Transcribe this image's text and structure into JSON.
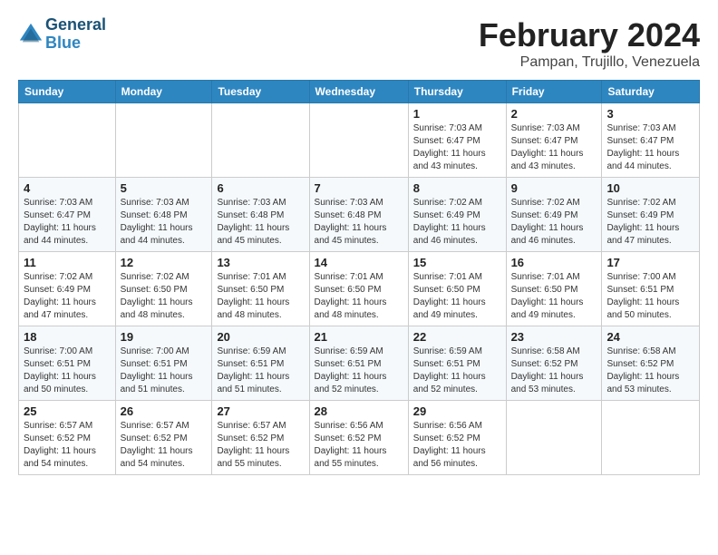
{
  "header": {
    "logo_line1": "General",
    "logo_line2": "Blue",
    "title": "February 2024",
    "location": "Pampan, Trujillo, Venezuela"
  },
  "days_of_week": [
    "Sunday",
    "Monday",
    "Tuesday",
    "Wednesday",
    "Thursday",
    "Friday",
    "Saturday"
  ],
  "weeks": [
    [
      {
        "day": "",
        "info": ""
      },
      {
        "day": "",
        "info": ""
      },
      {
        "day": "",
        "info": ""
      },
      {
        "day": "",
        "info": ""
      },
      {
        "day": "1",
        "info": "Sunrise: 7:03 AM\nSunset: 6:47 PM\nDaylight: 11 hours and 43 minutes."
      },
      {
        "day": "2",
        "info": "Sunrise: 7:03 AM\nSunset: 6:47 PM\nDaylight: 11 hours and 43 minutes."
      },
      {
        "day": "3",
        "info": "Sunrise: 7:03 AM\nSunset: 6:47 PM\nDaylight: 11 hours and 44 minutes."
      }
    ],
    [
      {
        "day": "4",
        "info": "Sunrise: 7:03 AM\nSunset: 6:47 PM\nDaylight: 11 hours and 44 minutes."
      },
      {
        "day": "5",
        "info": "Sunrise: 7:03 AM\nSunset: 6:48 PM\nDaylight: 11 hours and 44 minutes."
      },
      {
        "day": "6",
        "info": "Sunrise: 7:03 AM\nSunset: 6:48 PM\nDaylight: 11 hours and 45 minutes."
      },
      {
        "day": "7",
        "info": "Sunrise: 7:03 AM\nSunset: 6:48 PM\nDaylight: 11 hours and 45 minutes."
      },
      {
        "day": "8",
        "info": "Sunrise: 7:02 AM\nSunset: 6:49 PM\nDaylight: 11 hours and 46 minutes."
      },
      {
        "day": "9",
        "info": "Sunrise: 7:02 AM\nSunset: 6:49 PM\nDaylight: 11 hours and 46 minutes."
      },
      {
        "day": "10",
        "info": "Sunrise: 7:02 AM\nSunset: 6:49 PM\nDaylight: 11 hours and 47 minutes."
      }
    ],
    [
      {
        "day": "11",
        "info": "Sunrise: 7:02 AM\nSunset: 6:49 PM\nDaylight: 11 hours and 47 minutes."
      },
      {
        "day": "12",
        "info": "Sunrise: 7:02 AM\nSunset: 6:50 PM\nDaylight: 11 hours and 48 minutes."
      },
      {
        "day": "13",
        "info": "Sunrise: 7:01 AM\nSunset: 6:50 PM\nDaylight: 11 hours and 48 minutes."
      },
      {
        "day": "14",
        "info": "Sunrise: 7:01 AM\nSunset: 6:50 PM\nDaylight: 11 hours and 48 minutes."
      },
      {
        "day": "15",
        "info": "Sunrise: 7:01 AM\nSunset: 6:50 PM\nDaylight: 11 hours and 49 minutes."
      },
      {
        "day": "16",
        "info": "Sunrise: 7:01 AM\nSunset: 6:50 PM\nDaylight: 11 hours and 49 minutes."
      },
      {
        "day": "17",
        "info": "Sunrise: 7:00 AM\nSunset: 6:51 PM\nDaylight: 11 hours and 50 minutes."
      }
    ],
    [
      {
        "day": "18",
        "info": "Sunrise: 7:00 AM\nSunset: 6:51 PM\nDaylight: 11 hours and 50 minutes."
      },
      {
        "day": "19",
        "info": "Sunrise: 7:00 AM\nSunset: 6:51 PM\nDaylight: 11 hours and 51 minutes."
      },
      {
        "day": "20",
        "info": "Sunrise: 6:59 AM\nSunset: 6:51 PM\nDaylight: 11 hours and 51 minutes."
      },
      {
        "day": "21",
        "info": "Sunrise: 6:59 AM\nSunset: 6:51 PM\nDaylight: 11 hours and 52 minutes."
      },
      {
        "day": "22",
        "info": "Sunrise: 6:59 AM\nSunset: 6:51 PM\nDaylight: 11 hours and 52 minutes."
      },
      {
        "day": "23",
        "info": "Sunrise: 6:58 AM\nSunset: 6:52 PM\nDaylight: 11 hours and 53 minutes."
      },
      {
        "day": "24",
        "info": "Sunrise: 6:58 AM\nSunset: 6:52 PM\nDaylight: 11 hours and 53 minutes."
      }
    ],
    [
      {
        "day": "25",
        "info": "Sunrise: 6:57 AM\nSunset: 6:52 PM\nDaylight: 11 hours and 54 minutes."
      },
      {
        "day": "26",
        "info": "Sunrise: 6:57 AM\nSunset: 6:52 PM\nDaylight: 11 hours and 54 minutes."
      },
      {
        "day": "27",
        "info": "Sunrise: 6:57 AM\nSunset: 6:52 PM\nDaylight: 11 hours and 55 minutes."
      },
      {
        "day": "28",
        "info": "Sunrise: 6:56 AM\nSunset: 6:52 PM\nDaylight: 11 hours and 55 minutes."
      },
      {
        "day": "29",
        "info": "Sunrise: 6:56 AM\nSunset: 6:52 PM\nDaylight: 11 hours and 56 minutes."
      },
      {
        "day": "",
        "info": ""
      },
      {
        "day": "",
        "info": ""
      }
    ]
  ]
}
